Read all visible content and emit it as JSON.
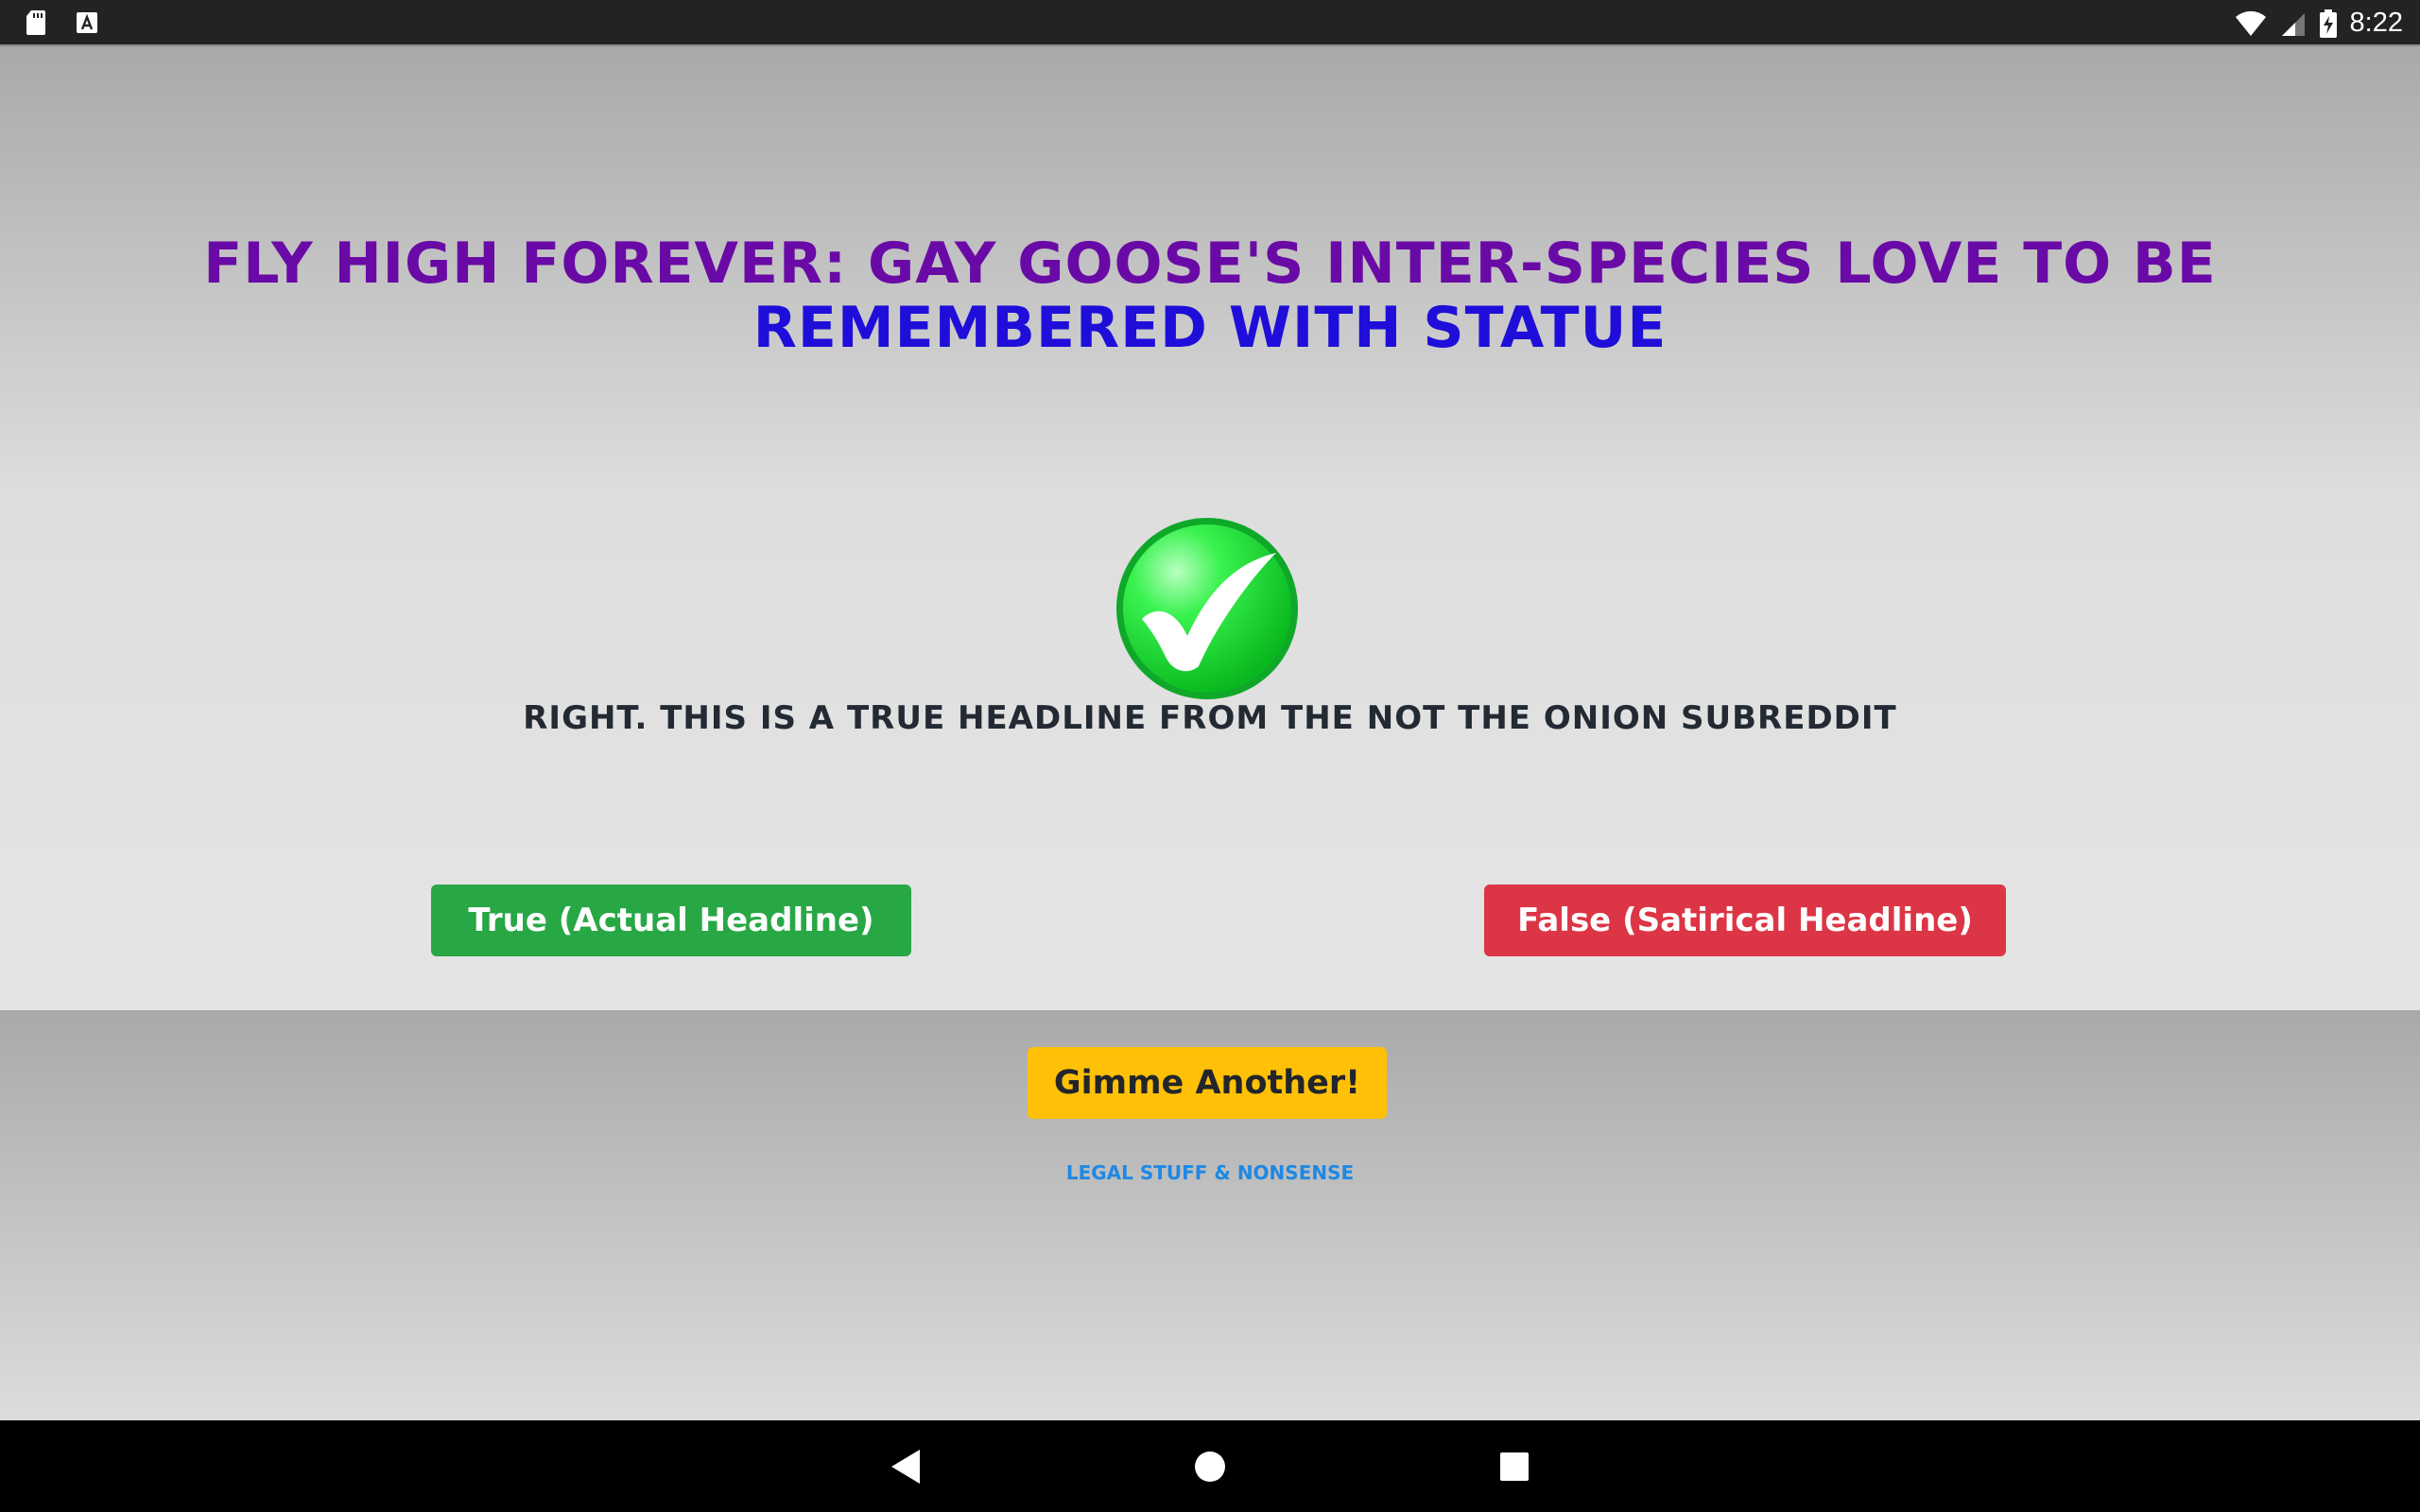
{
  "status_bar": {
    "left_icons": [
      "sd-card-icon",
      "font-a-icon"
    ],
    "right_icons": [
      "wifi-icon",
      "cell-signal-icon",
      "battery-charging-icon"
    ],
    "time": "8:22"
  },
  "headline": {
    "line1": "Fly High Forever: Gay Goose's Inter-Species Love to Be",
    "line2": "Remembered With Statue",
    "colors": {
      "line1": "#6a0aa6",
      "line2": "#1f0ed9"
    }
  },
  "result": {
    "icon": "green-check-icon",
    "text": "Right. This is a true headline from the Not The Onion subreddit"
  },
  "buttons": {
    "true_label": "True (Actual Headline)",
    "false_label": "False (Satirical Headline)",
    "another_label": "Gimme Another!",
    "colors": {
      "true": "#28a745",
      "false": "#dc3545",
      "another": "#ffc107"
    }
  },
  "footer": {
    "legal_label": "Legal Stuff & Nonsense"
  },
  "nav_bar": {
    "items": [
      "back-icon",
      "home-icon",
      "recents-icon"
    ]
  }
}
